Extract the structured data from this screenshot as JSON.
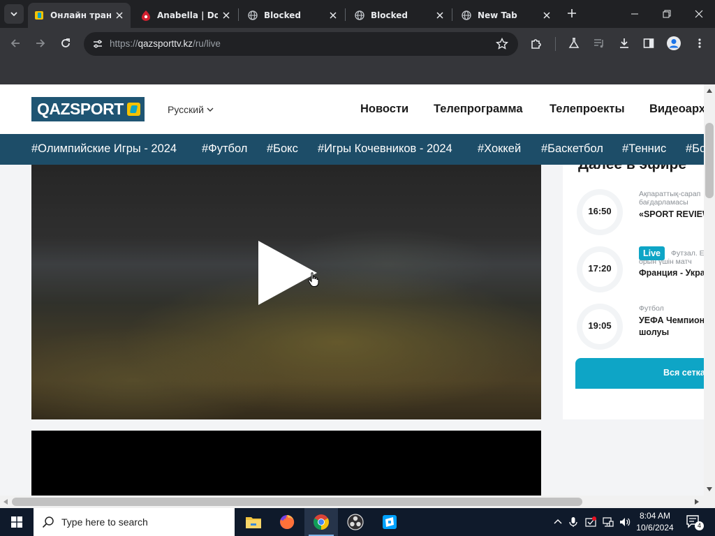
{
  "browser": {
    "tabs": [
      {
        "title": "Онлайн трансл",
        "active": true,
        "favicon": "qazsport-favicon"
      },
      {
        "title": "Anabella | Dok",
        "active": false,
        "favicon": "anabella-favicon"
      },
      {
        "title": "Blocked",
        "active": false,
        "favicon": "globe-icon"
      },
      {
        "title": "Blocked",
        "active": false,
        "favicon": "globe-icon"
      },
      {
        "title": "New Tab",
        "active": false,
        "favicon": "chrome-icon"
      }
    ],
    "address": {
      "scheme": "https://",
      "host": "qazsporttv.kz",
      "path": "/ru/live"
    },
    "colors": {
      "frame": "#202124",
      "toolbar": "#35363a"
    }
  },
  "site": {
    "logo_text": "QAZSPORT",
    "language": "Русский",
    "nav": [
      "Новости",
      "Телепрограмма",
      "Телепроекты",
      "Видеоарх"
    ],
    "tags": [
      "#Олимпийские Игры - 2024",
      "#Футбол",
      "#Бокс",
      "#Игры Кочевников - 2024",
      "#Хоккей",
      "#Баскетбол",
      "#Теннис",
      "#Бо"
    ],
    "colors": {
      "brand": "#1f5573",
      "tagbar": "#1d4d68",
      "accent": "#0ea5c6",
      "flag": "#f5c200"
    }
  },
  "sidebar": {
    "title": "Далее в эфире",
    "schedule": [
      {
        "time": "16:50",
        "live": false,
        "category": [
          "Ақпараттық-сарап",
          "бағдарламасы"
        ],
        "name": [
          "«SPORT REVIEW"
        ]
      },
      {
        "time": "17:20",
        "live": true,
        "live_label": "Live",
        "category": [
          "Футзал. Е",
          "орын үшін матч"
        ],
        "name": [
          "Франция - Укра"
        ]
      },
      {
        "time": "19:05",
        "live": false,
        "category": [
          "Футбол"
        ],
        "name": [
          "УЕФА Чемпион",
          "шолуы"
        ]
      }
    ],
    "all_button": "Вся сетка"
  },
  "taskbar": {
    "search_placeholder": "Type here to search",
    "time": "8:04 AM",
    "date": "10/6/2024",
    "notification_count": "4"
  }
}
